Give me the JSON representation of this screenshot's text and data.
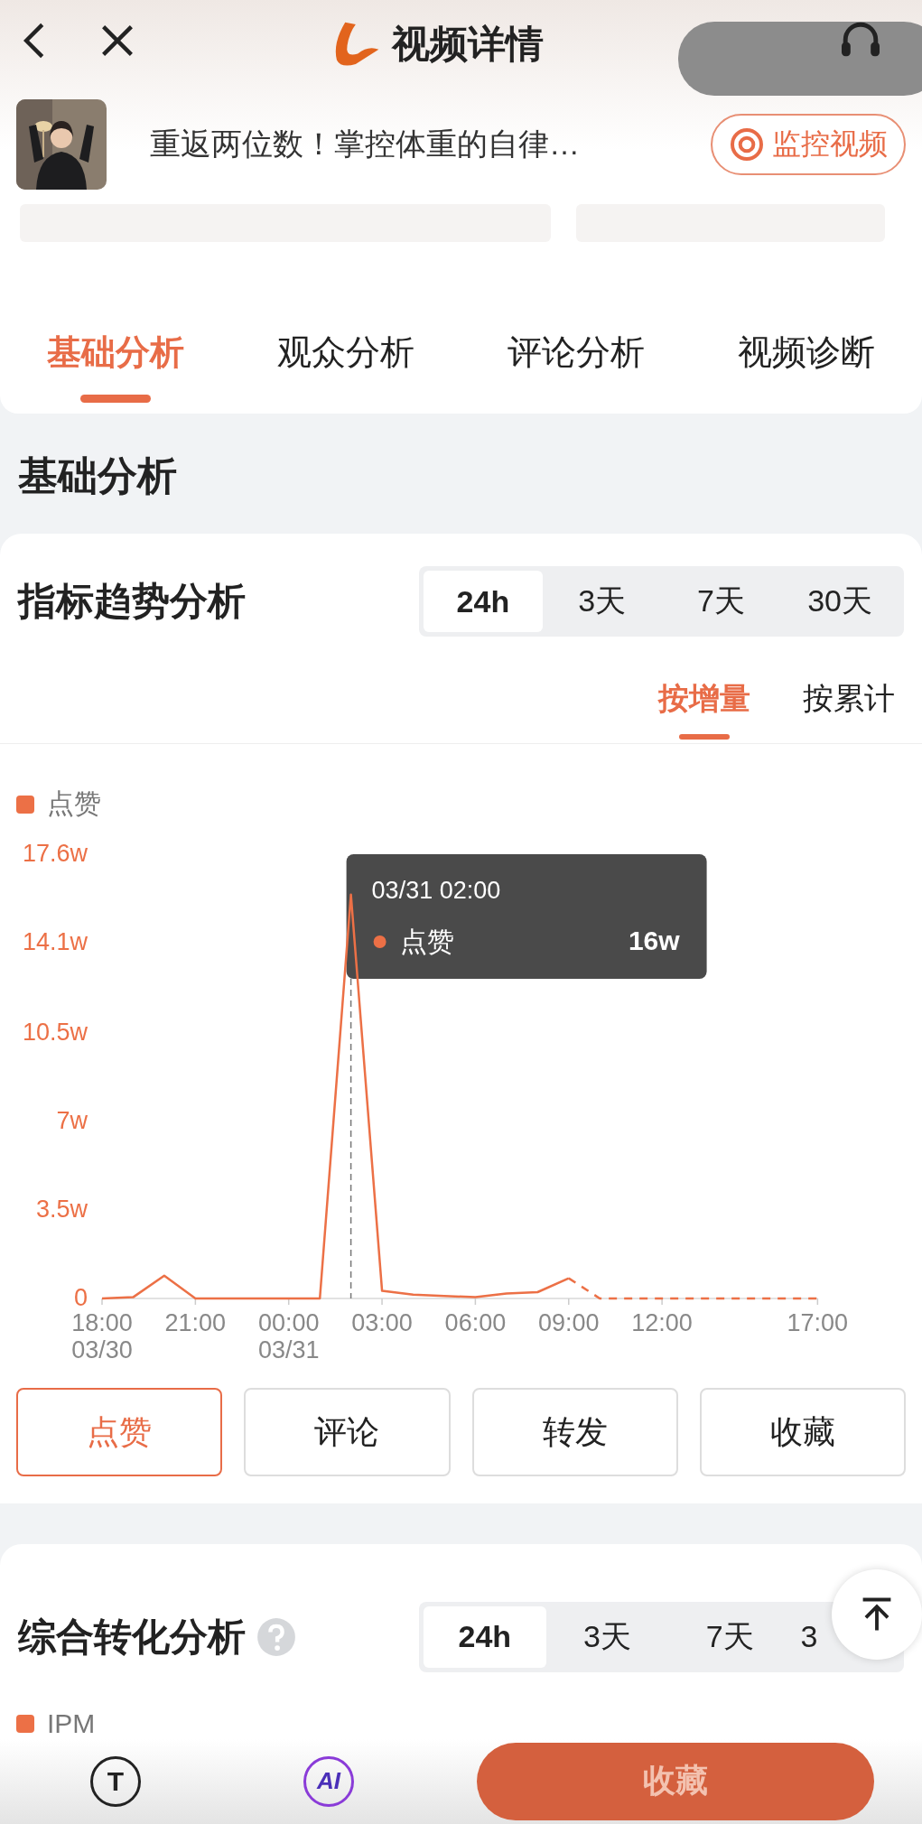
{
  "nav": {
    "title": "视频详情"
  },
  "video": {
    "title": "重返两位数！掌控体重的自律…",
    "monitor_button": "监控视频"
  },
  "tabs": [
    {
      "label": "基础分析",
      "selected": true
    },
    {
      "label": "观众分析",
      "selected": false
    },
    {
      "label": "评论分析",
      "selected": false
    },
    {
      "label": "视频诊断",
      "selected": false
    }
  ],
  "section_title": "基础分析",
  "trend": {
    "title": "指标趋势分析",
    "ranges": [
      {
        "label": "24h",
        "selected": true
      },
      {
        "label": "3天",
        "selected": false
      },
      {
        "label": "7天",
        "selected": false
      },
      {
        "label": "30天",
        "selected": false
      }
    ],
    "modes": [
      {
        "label": "按增量",
        "selected": true
      },
      {
        "label": "按累计",
        "selected": false
      }
    ],
    "tooltip": {
      "time": "03/31 02:00",
      "label": "点赞",
      "value": "16w"
    },
    "chart_data": {
      "type": "line",
      "categories": [
        "18:00\n03/30",
        null,
        null,
        "21:00",
        null,
        null,
        "00:00\n03/31",
        null,
        null,
        "03:00",
        null,
        null,
        "06:00",
        null,
        null,
        "09:00",
        null,
        null,
        "12:00",
        null,
        null,
        null,
        null,
        "17:00"
      ],
      "ylim": [
        0,
        17.6
      ],
      "yticks": [
        {
          "value": 0,
          "label": "0"
        },
        {
          "value": 3.5,
          "label": "3.5w"
        },
        {
          "value": 7,
          "label": "7w"
        },
        {
          "value": 10.5,
          "label": "10.5w"
        },
        {
          "value": 14.1,
          "label": "14.1w"
        },
        {
          "value": 17.6,
          "label": "17.6w"
        }
      ],
      "series": [
        {
          "name": "点赞",
          "color": "#ec7046",
          "values": [
            0,
            0.05,
            0.9,
            0,
            0,
            0,
            0,
            0,
            16,
            0.3,
            0.15,
            0.1,
            0.05,
            0.2,
            0.25,
            0.8,
            0,
            0,
            0,
            0,
            0,
            0,
            0,
            0
          ]
        }
      ]
    },
    "metrics": [
      {
        "label": "点赞",
        "selected": true
      },
      {
        "label": "评论",
        "selected": false
      },
      {
        "label": "转发",
        "selected": false
      },
      {
        "label": "收藏",
        "selected": false
      }
    ]
  },
  "conversion": {
    "title": "综合转化分析",
    "ranges": [
      {
        "label": "24h",
        "selected": true
      },
      {
        "label": "3天",
        "selected": false
      },
      {
        "label": "7天",
        "selected": false
      },
      {
        "label": "3",
        "selected": false
      }
    ],
    "legend": "IPM"
  },
  "bottom_bar": [
    {
      "kind": "icon",
      "label": "T"
    },
    {
      "kind": "ai",
      "label": "AI"
    },
    {
      "kind": "primary",
      "label": "收藏"
    }
  ]
}
